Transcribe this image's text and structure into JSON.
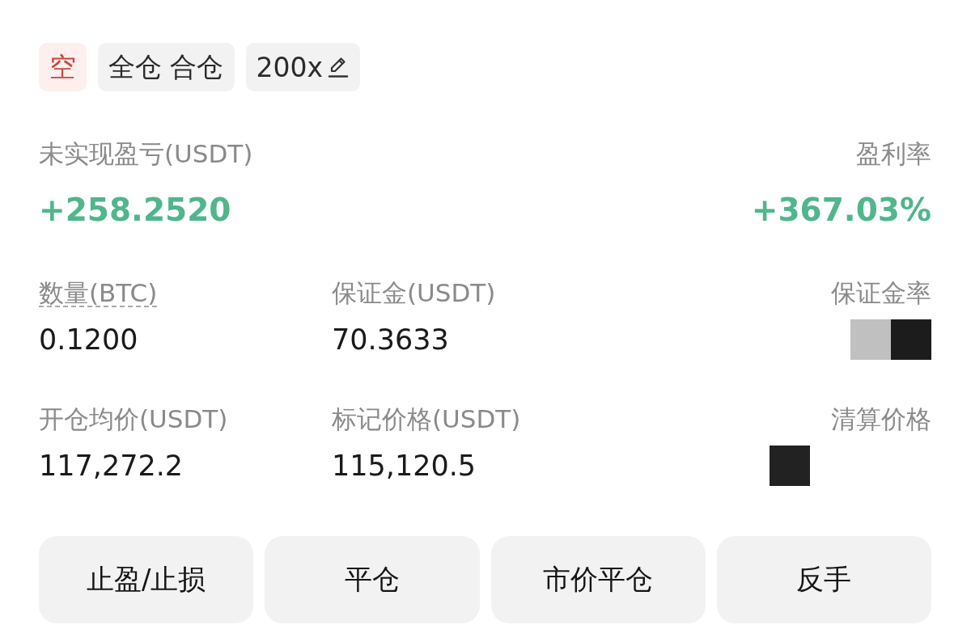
{
  "tags": [
    {
      "kind": "side",
      "text": "空"
    },
    {
      "kind": "mode",
      "text": "全仓 合仓"
    },
    {
      "kind": "leverage",
      "text": "200x"
    }
  ],
  "summary": [
    {
      "label": "未实现盈亏(USDT)",
      "value": "+258.2520"
    },
    {
      "label": "盈利率",
      "value": "+367.03%"
    }
  ],
  "fields": [
    [
      {
        "kind": "number",
        "label": "数量(BTC)",
        "underlined": true,
        "value": "0.1200"
      },
      {
        "kind": "number",
        "label": "保证金(USDT)",
        "underlined": false,
        "value": "70.3633"
      },
      {
        "kind": "masked",
        "label": "保证金率",
        "underlined": false
      }
    ],
    [
      {
        "kind": "number",
        "label": "开仓均价(USDT)",
        "underlined": false,
        "value": "117,272.2"
      },
      {
        "kind": "number",
        "label": "标记价格(USDT)",
        "underlined": false,
        "value": "115,120.5"
      },
      {
        "kind": "blacked",
        "label": "清算价格",
        "underlined": false
      }
    ]
  ],
  "actions": [
    "止盈/止损",
    "平仓",
    "市价平仓",
    "反手"
  ]
}
